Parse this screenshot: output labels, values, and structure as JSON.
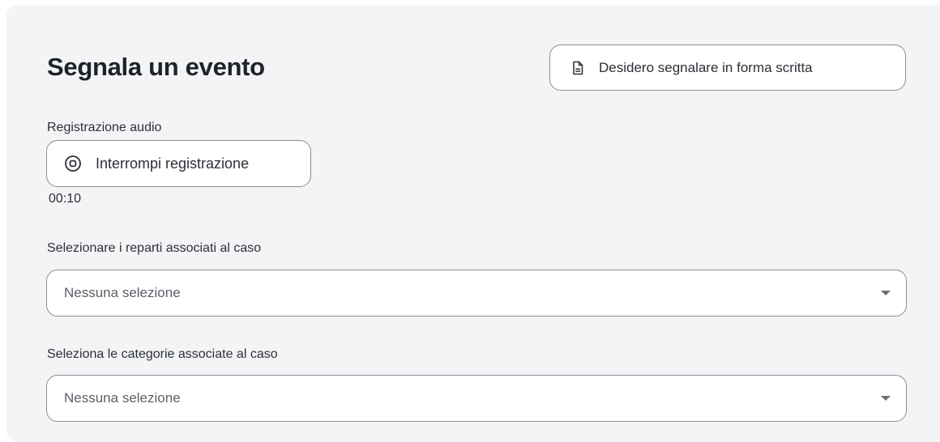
{
  "form": {
    "title": "Segnala un evento",
    "written_button_label": "Desidero segnalare in forma scritta",
    "written_button_icon": "document-icon",
    "audio": {
      "label": "Registrazione audio",
      "stop_button_label": "Interrompi registrazione",
      "stop_button_icon": "stop-record-icon",
      "elapsed": "00:10"
    },
    "departments": {
      "label": "Selezionare i reparti associati al caso",
      "value": "Nessuna selezione"
    },
    "categories": {
      "label": "Seleziona le categorie associate al caso",
      "value": "Nessuna selezione"
    }
  },
  "colors": {
    "card_background": "#f3f4f6",
    "border": "#8a8f96",
    "text": "#2c3036",
    "muted_text": "#5b6068"
  }
}
